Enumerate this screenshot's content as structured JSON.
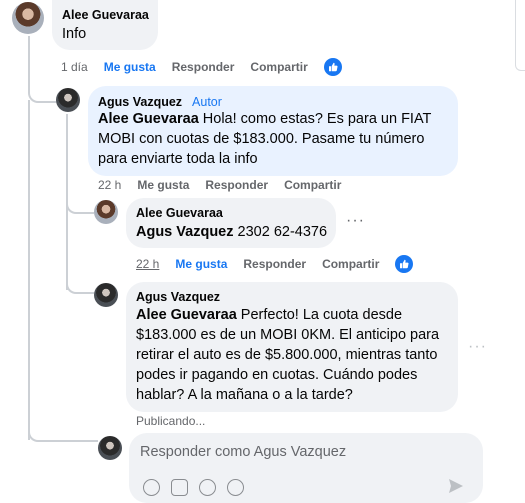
{
  "comment_top": {
    "author": "Alee Guevaraa",
    "text": "Info",
    "time": "1 día",
    "like": "Me gusta",
    "reply": "Responder",
    "share": "Compartir"
  },
  "reply_1": {
    "author": "Agus Vazquez",
    "badge": "Autor",
    "mention": "Alee Guevaraa",
    "text": " Hola! como estas? Es para un FIAT MOBI con cuotas de $183.000. Pasame tu número para enviarte toda la info",
    "time": "22 h",
    "like": "Me gusta",
    "reply": "Responder",
    "share": "Compartir"
  },
  "reply_2": {
    "author": "Alee Guevaraa",
    "mention": "Agus Vazquez",
    "text": " 2302 62-4376",
    "time": "22 h",
    "like": "Me gusta",
    "reply": "Responder",
    "share": "Compartir"
  },
  "reply_3": {
    "author": "Agus Vazquez",
    "mention": "Alee Guevaraa",
    "text": " Perfecto! La cuota desde $183.000 es de un MOBI 0KM. El anticipo para retirar el auto es de $5.800.000, mientras tanto podes ir pagando en cuotas. Cuándo podes hablar? A la mañana o a la tarde?",
    "status": "Publicando..."
  },
  "composer": {
    "placeholder": "Responder como Agus Vazquez"
  },
  "icons": [
    "like-reaction-icon",
    "more-options-icon",
    "emoji-icon",
    "camera-icon",
    "gif-icon",
    "sticker-icon",
    "send-icon"
  ],
  "colors": {
    "accent": "#1877f2",
    "bubble": "#f0f2f5",
    "bubble_highlight": "#e9f2ff",
    "secondary_text": "#65676b"
  }
}
